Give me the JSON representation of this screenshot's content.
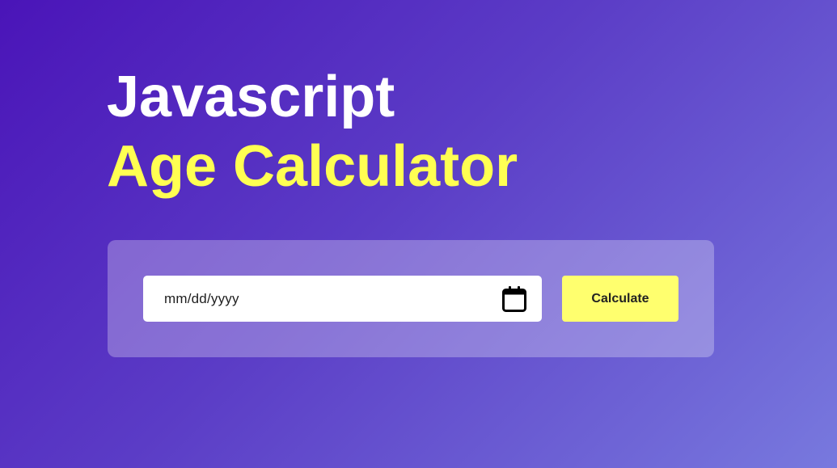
{
  "header": {
    "title_line1": "Javascript",
    "title_line2": "Age Calculator"
  },
  "form": {
    "date_input": {
      "placeholder": "mm/dd/yyyy",
      "value": "",
      "icon": "calendar-icon"
    },
    "calculate_label": "Calculate"
  },
  "colors": {
    "background_start": "#4a14b8",
    "background_end": "#7879de",
    "title_primary": "#ffffff",
    "title_accent": "#ffff52",
    "button_background": "#ffff6e",
    "button_text": "#222222",
    "input_background": "#ffffff"
  }
}
